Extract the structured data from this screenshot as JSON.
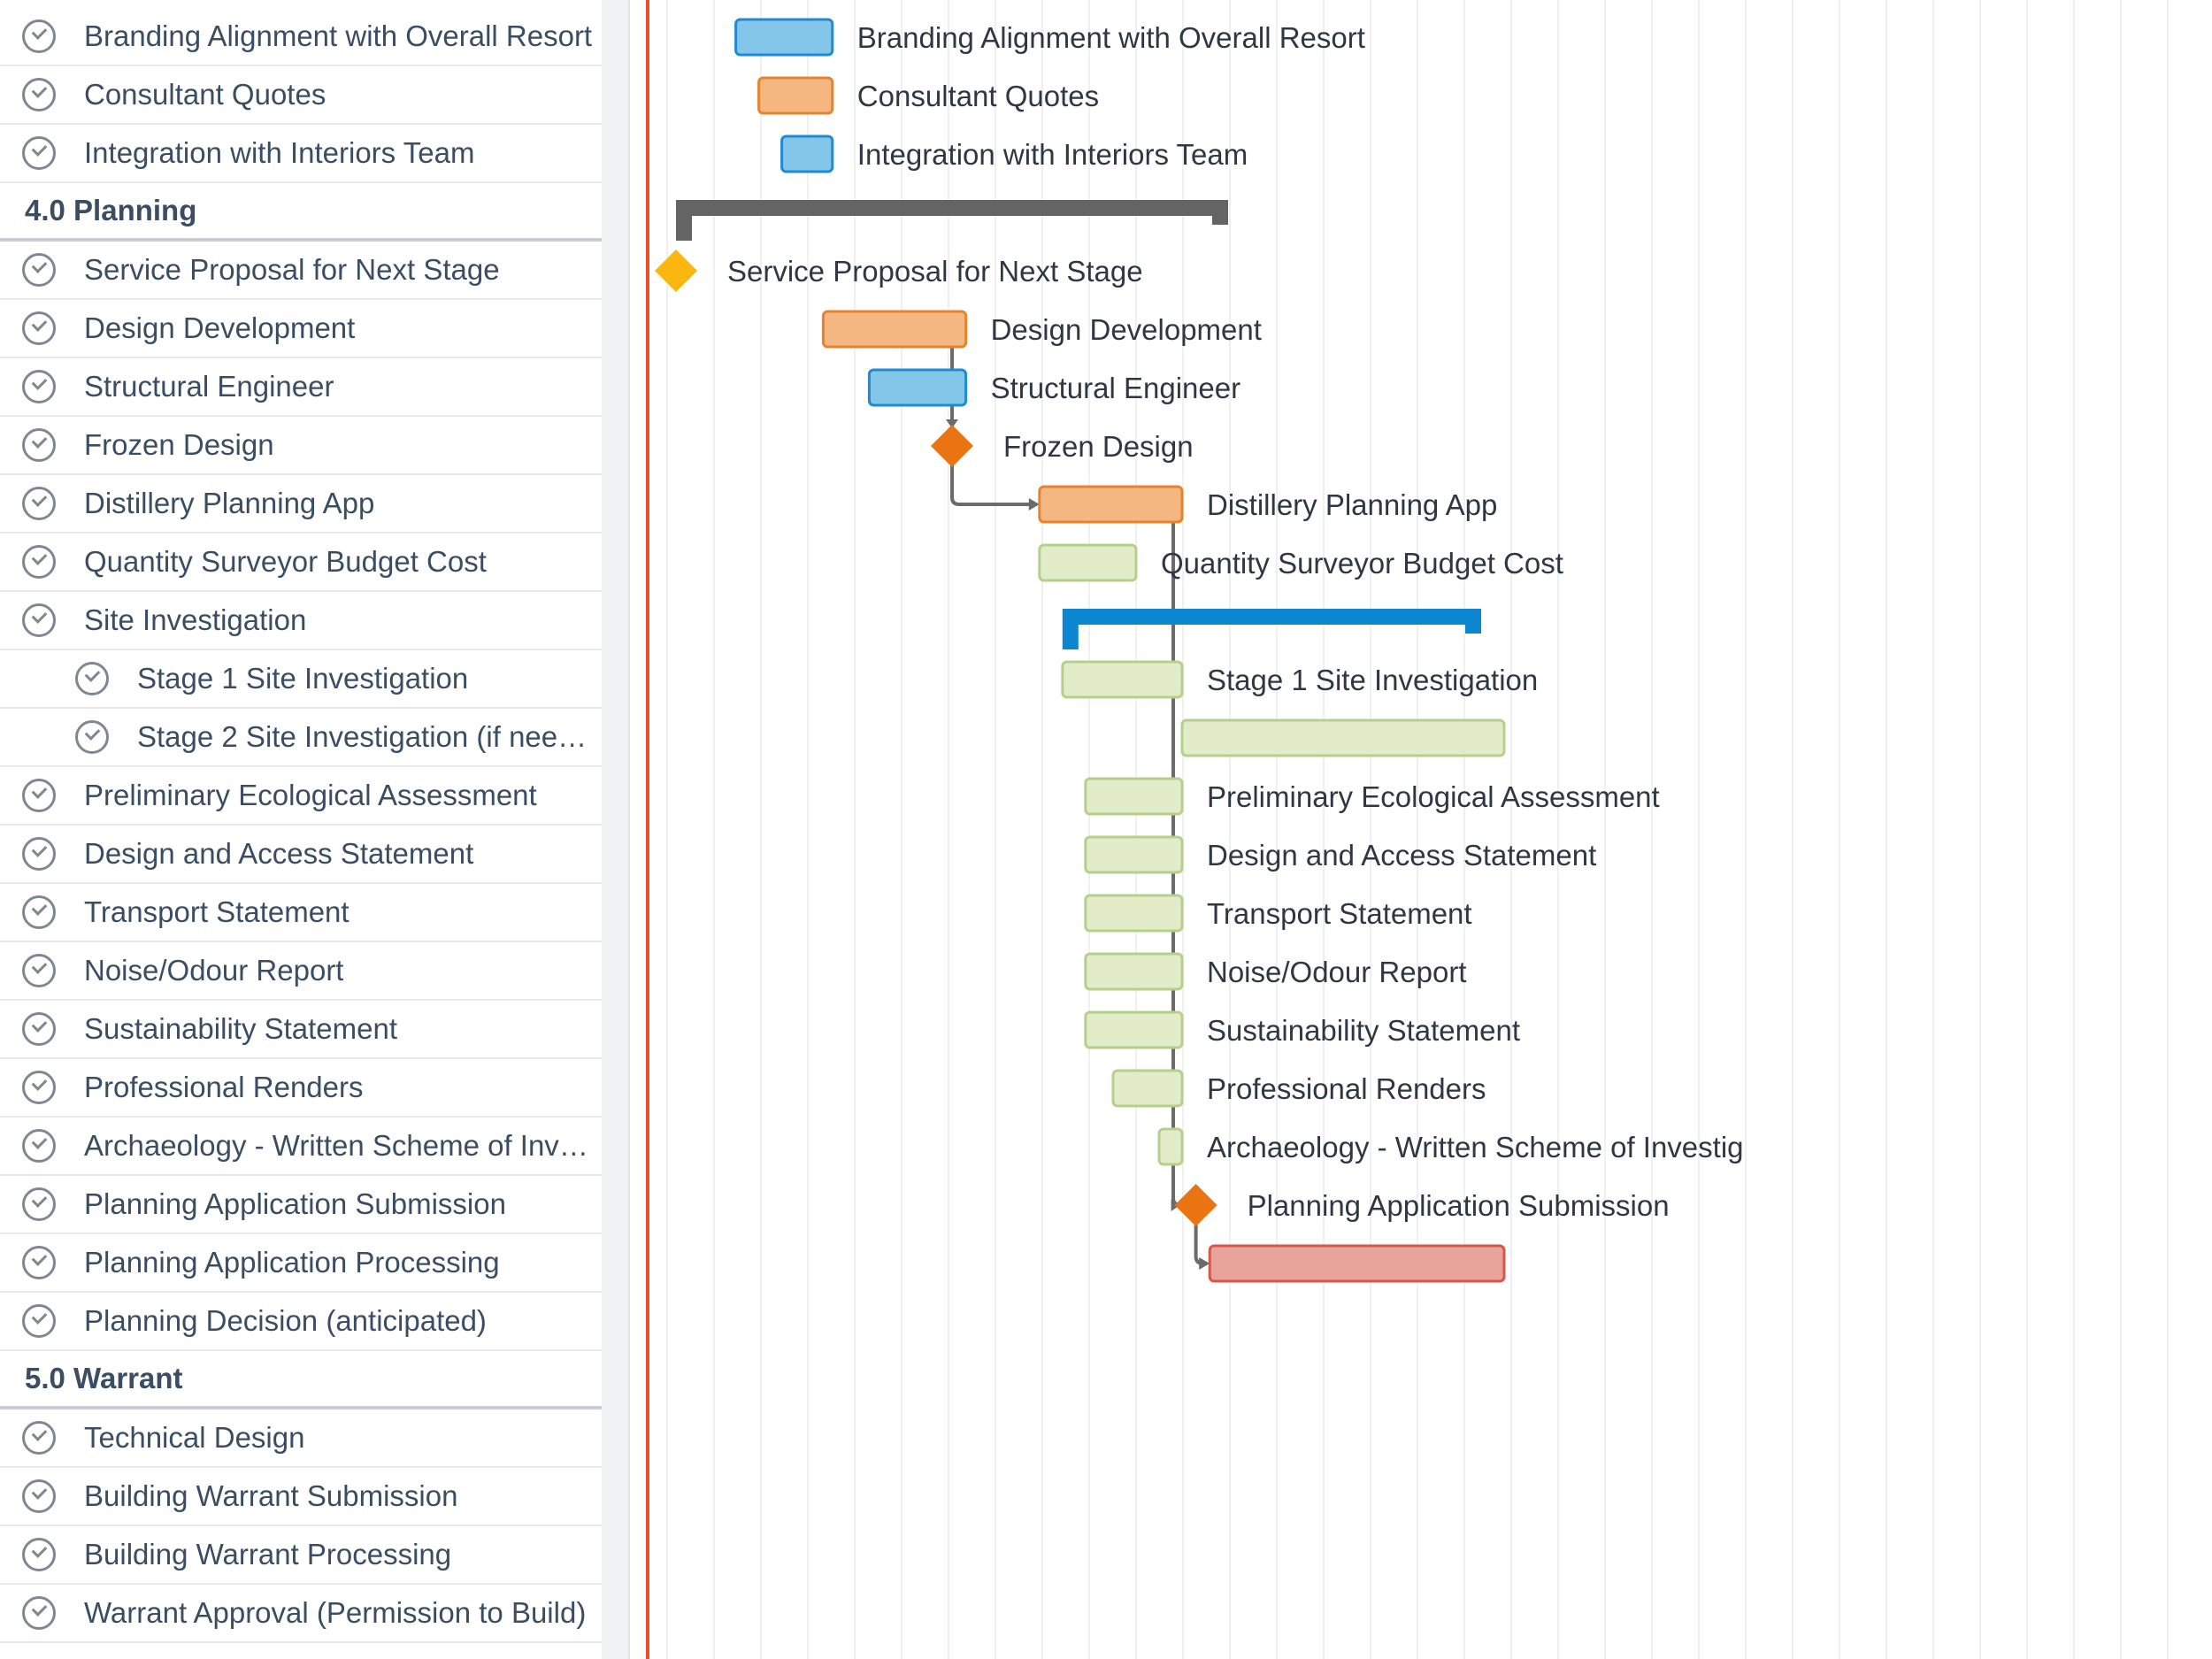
{
  "task_list": {
    "rows": [
      {
        "kind": "task",
        "name": "Branding Alignment with Overall Resort",
        "indent": 0
      },
      {
        "kind": "task",
        "name": "Consultant Quotes",
        "indent": 0
      },
      {
        "kind": "task",
        "name": "Integration with Interiors Team",
        "indent": 0
      },
      {
        "kind": "group",
        "name": "4.0 Planning"
      },
      {
        "kind": "task",
        "name": "Service Proposal for Next Stage",
        "indent": 0
      },
      {
        "kind": "task",
        "name": "Design Development",
        "indent": 0
      },
      {
        "kind": "task",
        "name": "Structural Engineer",
        "indent": 0
      },
      {
        "kind": "task",
        "name": "Frozen Design",
        "indent": 0
      },
      {
        "kind": "task",
        "name": "Distillery Planning App",
        "indent": 0
      },
      {
        "kind": "task",
        "name": "Quantity Surveyor Budget Cost",
        "indent": 0
      },
      {
        "kind": "task",
        "name": "Site Investigation",
        "indent": 0
      },
      {
        "kind": "task",
        "name": "Stage 1 Site Investigation",
        "indent": 1
      },
      {
        "kind": "task",
        "name": "Stage 2 Site Investigation (if need...",
        "indent": 1
      },
      {
        "kind": "task",
        "name": "Preliminary Ecological Assessment",
        "indent": 0
      },
      {
        "kind": "task",
        "name": "Design and Access Statement",
        "indent": 0
      },
      {
        "kind": "task",
        "name": "Transport Statement",
        "indent": 0
      },
      {
        "kind": "task",
        "name": "Noise/Odour Report",
        "indent": 0
      },
      {
        "kind": "task",
        "name": "Sustainability Statement",
        "indent": 0
      },
      {
        "kind": "task",
        "name": "Professional Renders",
        "indent": 0
      },
      {
        "kind": "task",
        "name": "Archaeology - Written Scheme of Inve...",
        "indent": 0
      },
      {
        "kind": "task",
        "name": "Planning Application Submission",
        "indent": 0
      },
      {
        "kind": "task",
        "name": "Planning Application Processing",
        "indent": 0
      },
      {
        "kind": "task",
        "name": "Planning Decision (anticipated)",
        "indent": 0
      },
      {
        "kind": "group",
        "name": "5.0 Warrant"
      },
      {
        "kind": "task",
        "name": "Technical Design",
        "indent": 0
      },
      {
        "kind": "task",
        "name": "Building Warrant Submission",
        "indent": 0
      },
      {
        "kind": "task",
        "name": "Building Warrant Processing",
        "indent": 0
      },
      {
        "kind": "task",
        "name": "Warrant Approval (Permission to Build)",
        "indent": 0
      }
    ]
  },
  "gantt": {
    "colors": {
      "blue": "#84c5ea",
      "blue_border": "#1e8bd3",
      "orange": "#f4b781",
      "orange_border": "#e8832d",
      "green": "#e2ecc9",
      "green_border": "#b5d08d",
      "red": "#e8a49a",
      "red_border": "#d8564a",
      "milestone_orange": "#e97411",
      "milestone_yellow": "#fbb70f",
      "group_dark": "#646464",
      "group_blue": "#0c86d0",
      "connector": "#6b6b6b",
      "grid": "#eff0f2"
    },
    "bars": [
      {
        "row": 0,
        "type": "bar",
        "color": "blue",
        "start": 0.13,
        "end": 0.34,
        "label": "Branding Alignment with Overall Resort"
      },
      {
        "row": 1,
        "type": "bar",
        "color": "orange",
        "start": 0.18,
        "end": 0.34,
        "label": "Consultant Quotes"
      },
      {
        "row": 2,
        "type": "bar",
        "color": "blue",
        "start": 0.23,
        "end": 0.34,
        "label": "Integration with Interiors Team"
      },
      {
        "row": 3,
        "type": "group",
        "color": "group_dark",
        "start": 0.0,
        "end": 1.2,
        "label": ""
      },
      {
        "row": 4,
        "type": "milestone",
        "color": "milestone_yellow",
        "start": 0.0,
        "end": 0.0,
        "label": "Service Proposal for Next Stage"
      },
      {
        "row": 5,
        "type": "bar",
        "color": "orange",
        "start": 0.32,
        "end": 0.63,
        "label": "Design Development"
      },
      {
        "row": 6,
        "type": "bar",
        "color": "blue",
        "start": 0.42,
        "end": 0.63,
        "label": "Structural Engineer"
      },
      {
        "row": 7,
        "type": "milestone",
        "color": "milestone_orange",
        "start": 0.6,
        "end": 0.6,
        "label": "Frozen Design"
      },
      {
        "row": 8,
        "type": "bar",
        "color": "orange",
        "start": 0.79,
        "end": 1.1,
        "label": "Distillery Planning App"
      },
      {
        "row": 9,
        "type": "bar",
        "color": "green",
        "start": 0.79,
        "end": 1.0,
        "label": "Quantity Surveyor Budget Cost"
      },
      {
        "row": 10,
        "type": "group",
        "color": "group_blue",
        "start": 0.84,
        "end": 1.75,
        "label": ""
      },
      {
        "row": 11,
        "type": "bar",
        "color": "green",
        "start": 0.84,
        "end": 1.1,
        "label": "Stage 1 Site Investigation"
      },
      {
        "row": 12,
        "type": "bar",
        "color": "green",
        "start": 1.1,
        "end": 1.8,
        "label": ""
      },
      {
        "row": 13,
        "type": "bar",
        "color": "green",
        "start": 0.89,
        "end": 1.1,
        "label": "Preliminary Ecological Assessment"
      },
      {
        "row": 14,
        "type": "bar",
        "color": "green",
        "start": 0.89,
        "end": 1.1,
        "label": "Design and Access Statement"
      },
      {
        "row": 15,
        "type": "bar",
        "color": "green",
        "start": 0.89,
        "end": 1.1,
        "label": "Transport Statement"
      },
      {
        "row": 16,
        "type": "bar",
        "color": "green",
        "start": 0.89,
        "end": 1.1,
        "label": "Noise/Odour Report"
      },
      {
        "row": 17,
        "type": "bar",
        "color": "green",
        "start": 0.89,
        "end": 1.1,
        "label": "Sustainability Statement"
      },
      {
        "row": 18,
        "type": "bar",
        "color": "green",
        "start": 0.95,
        "end": 1.1,
        "label": "Professional Renders"
      },
      {
        "row": 19,
        "type": "bar",
        "color": "green",
        "start": 1.05,
        "end": 1.1,
        "label": "Archaeology - Written Scheme of Investig"
      },
      {
        "row": 20,
        "type": "milestone",
        "color": "milestone_orange",
        "start": 1.13,
        "end": 1.13,
        "label": "Planning Application Submission"
      },
      {
        "row": 21,
        "type": "bar",
        "color": "red",
        "start": 1.16,
        "end": 1.8,
        "label": ""
      }
    ],
    "dependencies": [
      {
        "from": 5,
        "to": 7,
        "kind": "finish-start-down"
      },
      {
        "from": 7,
        "to": 8,
        "kind": "finish-start-right"
      },
      {
        "from": 8,
        "to": 19,
        "kind": "trunk"
      },
      {
        "from": 19,
        "to": 20,
        "kind": "finish-start-right"
      },
      {
        "from": 20,
        "to": 21,
        "kind": "finish-start-right"
      }
    ]
  }
}
